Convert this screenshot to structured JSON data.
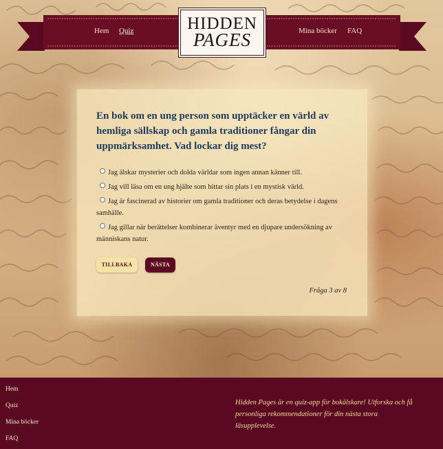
{
  "header": {
    "nav_left": [
      "Hem",
      "Quiz"
    ],
    "nav_right": [
      "Mina böcker",
      "FAQ"
    ],
    "active": "Quiz",
    "logo_line1": "HIDDEN",
    "logo_line2": "PAGES"
  },
  "quiz": {
    "question": "En bok om en ung person som upptäcker en värld av hemliga sällskap och gamla traditioner fångar din uppmärksamhet. Vad lockar dig mest?",
    "options": [
      "Jag älskar mysterier och dolda världar som ingen annan känner till.",
      "Jag vill läsa om en ung hjälte som hittar sin plats i en mystisk värld.",
      "Jag är fascinerad av historier om gamla traditioner och deras betydelse i dagens samhälle.",
      "Jag gillar när berättelser kombinerar äventyr med en djupare undersökning av människans natur."
    ],
    "back_label": "TILLBAKA",
    "next_label": "NÄSTA",
    "progress": "Fråga 3 av 8"
  },
  "footer": {
    "links": [
      "Hem",
      "Quiz",
      "Mina böcker",
      "FAQ"
    ],
    "text": "Hidden Pages är en quiz-app för bokälskare! Utforska och få personliga rekommendationer för din nästa stora läsupplevelse."
  },
  "colors": {
    "burgundy": "#5a0a20",
    "question_blue": "#1f3a5e",
    "parchment": "#f8e8be",
    "gold_text": "#f4d9a0"
  }
}
